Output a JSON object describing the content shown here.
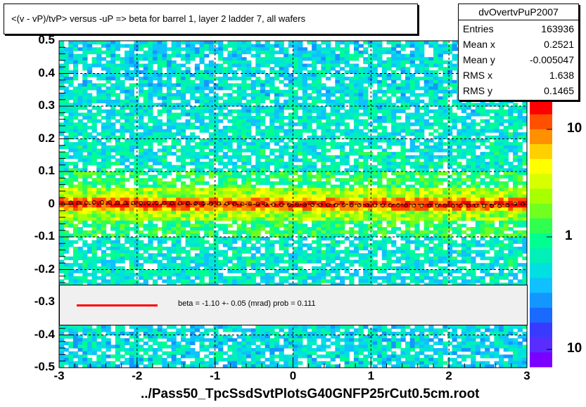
{
  "title": "<(v - vP)/tvP> versus  -uP => beta for barrel 1, layer 2 ladder 7, all wafers",
  "stats": {
    "name": "dvOvertvPuP2007",
    "rows": [
      {
        "label": "Entries",
        "value": "163936"
      },
      {
        "label": "Mean x",
        "value": "0.2521"
      },
      {
        "label": "Mean y",
        "value": "-0.005047"
      },
      {
        "label": "RMS x",
        "value": "1.638"
      },
      {
        "label": "RMS y",
        "value": "0.1465"
      }
    ]
  },
  "legend": {
    "text": "beta =   -1.10 +-  0.05 (mrad) prob = 0.111",
    "line_color": "#ff0000"
  },
  "chart_data": {
    "type": "heatmap",
    "title": "<(v - vP)/tvP> versus  -uP => beta for barrel 1, layer 2 ladder 7, all wafers",
    "xlabel": "../Pass50_TpcSsdSvtPlotsG40GNFP25rCut0.5cm.root",
    "ylabel": "",
    "xlim": [
      -3,
      3
    ],
    "ylim": [
      -0.5,
      0.5
    ],
    "x_ticks": [
      -3,
      -2,
      -1,
      0,
      1,
      2,
      3
    ],
    "x_tick_labels": [
      "-3",
      "-2",
      "-1",
      "0",
      "1",
      "2",
      "3"
    ],
    "y_ticks": [
      -0.5,
      -0.4,
      -0.3,
      -0.2,
      -0.1,
      0,
      0.1,
      0.2,
      0.3,
      0.4,
      0.5
    ],
    "y_tick_labels": [
      "-0.5",
      "-0.4",
      "-0.3",
      "-0.2",
      "-0.1",
      "0",
      "0.1",
      "0.2",
      "0.3",
      "0.4",
      "0.5"
    ],
    "z_scale": "log",
    "z_tick_labels": [
      "10",
      "1",
      "10"
    ],
    "grid": true,
    "band_center_y": 0.0,
    "profile_points": {
      "x": [
        -2.9,
        -2.7,
        -2.5,
        -2.3,
        -2.1,
        -1.9,
        -1.7,
        -1.5,
        -1.3,
        -1.1,
        -0.9,
        -0.7,
        -0.5,
        -0.3,
        -0.1,
        0.1,
        0.3,
        0.5,
        0.7,
        0.9,
        1.1,
        1.3,
        1.5,
        1.7,
        1.9,
        2.1,
        2.3,
        2.5,
        2.7,
        2.9
      ],
      "y": [
        0.005,
        0.004,
        0.006,
        0.005,
        0.004,
        0.003,
        0.004,
        0.003,
        0.002,
        0.001,
        0.002,
        0.0,
        0.001,
        -0.001,
        -0.002,
        -0.001,
        -0.002,
        -0.003,
        -0.002,
        -0.003,
        -0.004,
        -0.003,
        -0.004,
        -0.005,
        -0.004,
        -0.005,
        -0.004,
        -0.006,
        -0.005,
        0.004
      ]
    },
    "fit_line": {
      "slope_mrad": -1.1,
      "error_mrad": 0.05,
      "prob": 0.111
    }
  },
  "colors": {
    "palette": [
      "#7a00ff",
      "#5a2dff",
      "#3a3aff",
      "#1a6aff",
      "#1496ff",
      "#10c0ff",
      "#00e0e0",
      "#00f0b8",
      "#00ff90",
      "#30ff50",
      "#70ff20",
      "#a8ff00",
      "#d8ff00",
      "#ffff00",
      "#ffd000",
      "#ff9000",
      "#ff5000",
      "#ff0000"
    ]
  }
}
